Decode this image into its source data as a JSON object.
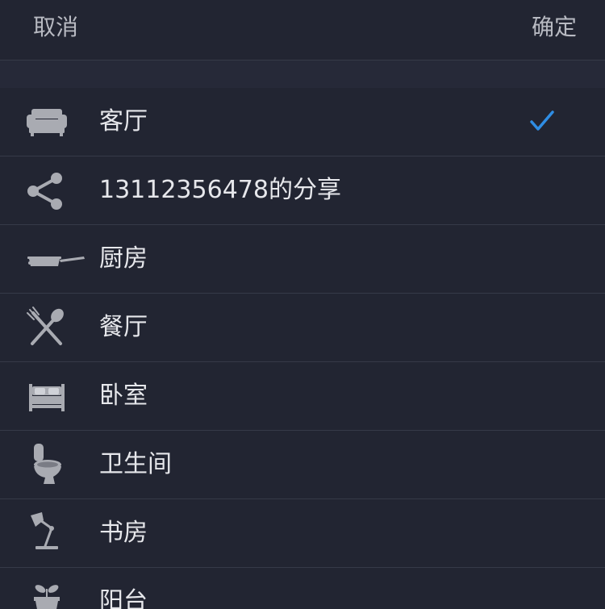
{
  "header": {
    "cancel_label": "取消",
    "confirm_label": "确定"
  },
  "rooms": [
    {
      "label": "客厅",
      "icon": "sofa-icon",
      "selected": true
    },
    {
      "label": "13112356478的分享",
      "icon": "share-icon",
      "selected": false
    },
    {
      "label": "厨房",
      "icon": "frying-pan-icon",
      "selected": false
    },
    {
      "label": "餐厅",
      "icon": "fork-spoon-icon",
      "selected": false
    },
    {
      "label": "卧室",
      "icon": "bed-icon",
      "selected": false
    },
    {
      "label": "卫生间",
      "icon": "toilet-icon",
      "selected": false
    },
    {
      "label": "书房",
      "icon": "desk-lamp-icon",
      "selected": false
    },
    {
      "label": "阳台",
      "icon": "potted-plant-icon",
      "selected": false
    }
  ],
  "colors": {
    "background": "#222532",
    "divider": "#363a48",
    "text": "#e6e7eb",
    "header_text": "#b8bac2",
    "icon": "#a9abb2",
    "check": "#2f8de4"
  }
}
